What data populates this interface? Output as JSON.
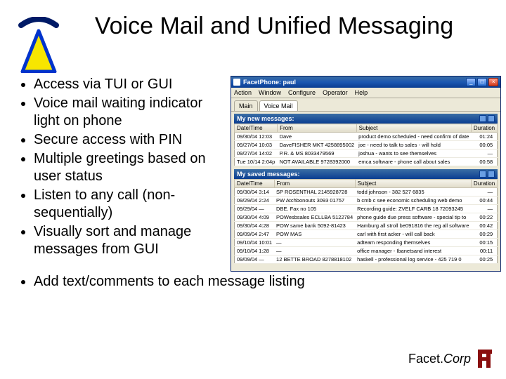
{
  "slide": {
    "title": "Voice Mail and Unified Messaging",
    "bullets": [
      "Access via TUI or GUI",
      "Voice mail waiting indicator light on phone",
      "Secure access with PIN",
      "Multiple greetings based on user status",
      "Listen to any call (non-sequentially)",
      "Visually sort and manage messages from GUI"
    ],
    "last_bullet": "Add text/comments to each message listing"
  },
  "app": {
    "title": "FacetPhone: paul",
    "menu": [
      "Action",
      "Window",
      "Configure",
      "Operator",
      "Help"
    ],
    "tabs": [
      "Main",
      "Voice Mail"
    ],
    "columns": [
      "Date/Time",
      "From",
      "Subject",
      "Duration"
    ],
    "panel1": {
      "title": "My new messages:",
      "rows": [
        {
          "dt": "09/30/04 12:03",
          "from": "Dave",
          "subj": "product demo scheduled - need confirm of date",
          "dur": "01:24"
        },
        {
          "dt": "09/27/04 10:03",
          "from": "DaveFISHER MKT 4258895002",
          "subj": "joe - need to talk to sales - will hold",
          "dur": "00:05"
        },
        {
          "dt": "09/27/04 14:02",
          "from": "P.R. & MS 8033479569",
          "subj": "joshua - wants to see themselves",
          "dur": "—"
        },
        {
          "dt": "Tue 10/14 2:04p",
          "from": "NOT AVAILABLE 9728392000",
          "subj": "emca software - phone call about sales",
          "dur": "00:58"
        }
      ]
    },
    "panel2": {
      "title": "My saved messages:",
      "rows": [
        {
          "dt": "09/30/04 3:14",
          "from": "SP ROSENTHAL 2145928728",
          "subj": "todd johnson - 382 527 6835",
          "dur": "—"
        },
        {
          "dt": "09/29/04 2:24",
          "from": "PW Atchbonouts 3093 01757",
          "subj": "b cmb c see economic scheduling web demo",
          "dur": "00:44"
        },
        {
          "dt": "09/29/04 —",
          "from": "DBE. Fax no 105",
          "subj": "Recording guide: ZVELF CARB 18 72093245",
          "dur": "—"
        },
        {
          "dt": "09/30/04 4:09",
          "from": "POWesbsales ECLLBA 5122784",
          "subj": "phone guide due press software - special tip to",
          "dur": "00:22"
        },
        {
          "dt": "09/30/04 4:28",
          "from": "POW same bank 5092-81423",
          "subj": "Hamburg all stroll be091816 the reg all software",
          "dur": "00:42"
        },
        {
          "dt": "09/09/04 2:47",
          "from": "POW MAS",
          "subj": "carl with first acker - will call back",
          "dur": "00:29"
        },
        {
          "dt": "09/10/04 10:01",
          "from": "—",
          "subj": "adteam responding themselves",
          "dur": "00:15"
        },
        {
          "dt": "09/10/04 1:28",
          "from": "—",
          "subj": "office manager - Ibanetsand interest",
          "dur": "00:11"
        },
        {
          "dt": "09/09/04 —",
          "from": "12 BETTE BROAD 8278818102",
          "subj": "haskell - professional log service - 425 719 0",
          "dur": "00:25"
        }
      ]
    },
    "winbtns": {
      "min": "_",
      "max": "□",
      "close": "×"
    }
  },
  "brand": {
    "name": "Facet.",
    "suffix": "Corp"
  }
}
